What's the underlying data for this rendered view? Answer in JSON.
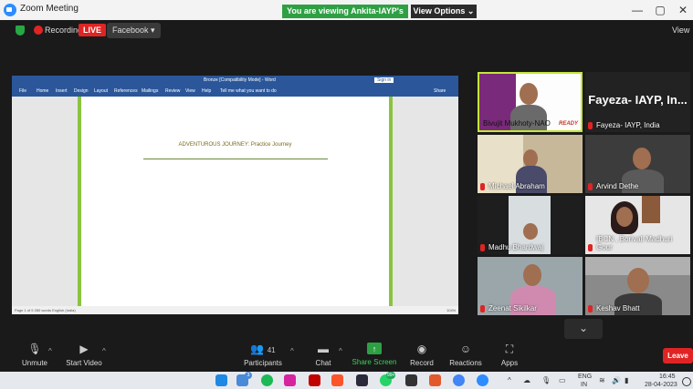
{
  "window": {
    "title": "Zoom Meeting",
    "minimize": "—",
    "maximize": "▢",
    "close": "✕"
  },
  "banner": {
    "viewing": "You are viewing Ankita-IAYP's screen",
    "view_options": "View Options ⌄"
  },
  "meeting_bar": {
    "recording": "Recording",
    "live": "LIVE",
    "facebook": "Facebook ▾",
    "view": "View"
  },
  "shared_screen": {
    "word_title": "Bronze [Compatibility Mode] - Word",
    "sign_in": "Sign in",
    "ribbon_tabs": [
      "File",
      "Home",
      "Insert",
      "Design",
      "Layout",
      "References",
      "Mailings",
      "Review",
      "View",
      "Help",
      "Tell me what you want to do"
    ],
    "share": "Share",
    "heading": "ADVENTUROUS JOURNEY: Practice Journey",
    "status_left": "Page 1 of 9   280 words   English (India)",
    "zoom": "104%"
  },
  "participants_tiles": [
    {
      "name": "Bivujit Mukhoty-NAO",
      "muted": false
    },
    {
      "name": "Fayeza- IAYP, India",
      "muted": true,
      "big_label": "Fayeza- IAYP, In..."
    },
    {
      "name": "Michael Abraham",
      "muted": true
    },
    {
      "name": "Arvind Dethe",
      "muted": true
    },
    {
      "name": "Madhu Bhardwaj",
      "muted": true
    },
    {
      "name": "IBCN , Borivali Madhuri Gour",
      "muted": true
    },
    {
      "name": "Zeenat Sikilkar",
      "muted": true
    },
    {
      "name": "Keshav Bhatt",
      "muted": true
    }
  ],
  "tile_extra": {
    "ready": "READY"
  },
  "toolbar": {
    "unmute": "Unmute",
    "start_video": "Start Video",
    "participants": "Participants",
    "participants_count": "41",
    "chat": "Chat",
    "share_screen": "Share Screen",
    "record": "Record",
    "reactions": "Reactions",
    "apps": "Apps",
    "leave": "Leave",
    "chevron": "⌄"
  },
  "taskbar": {
    "lang": "ENG",
    "lang2": "IN",
    "time": "16:45",
    "date": "28-04-2023",
    "badge1": "3",
    "badge2": "99+"
  },
  "colors": {
    "zoom_blue": "#2d8cff",
    "banner_green": "#2ea043",
    "leave_red": "#e02424",
    "word_blue": "#2b579a",
    "page_border": "#8ac43f"
  }
}
